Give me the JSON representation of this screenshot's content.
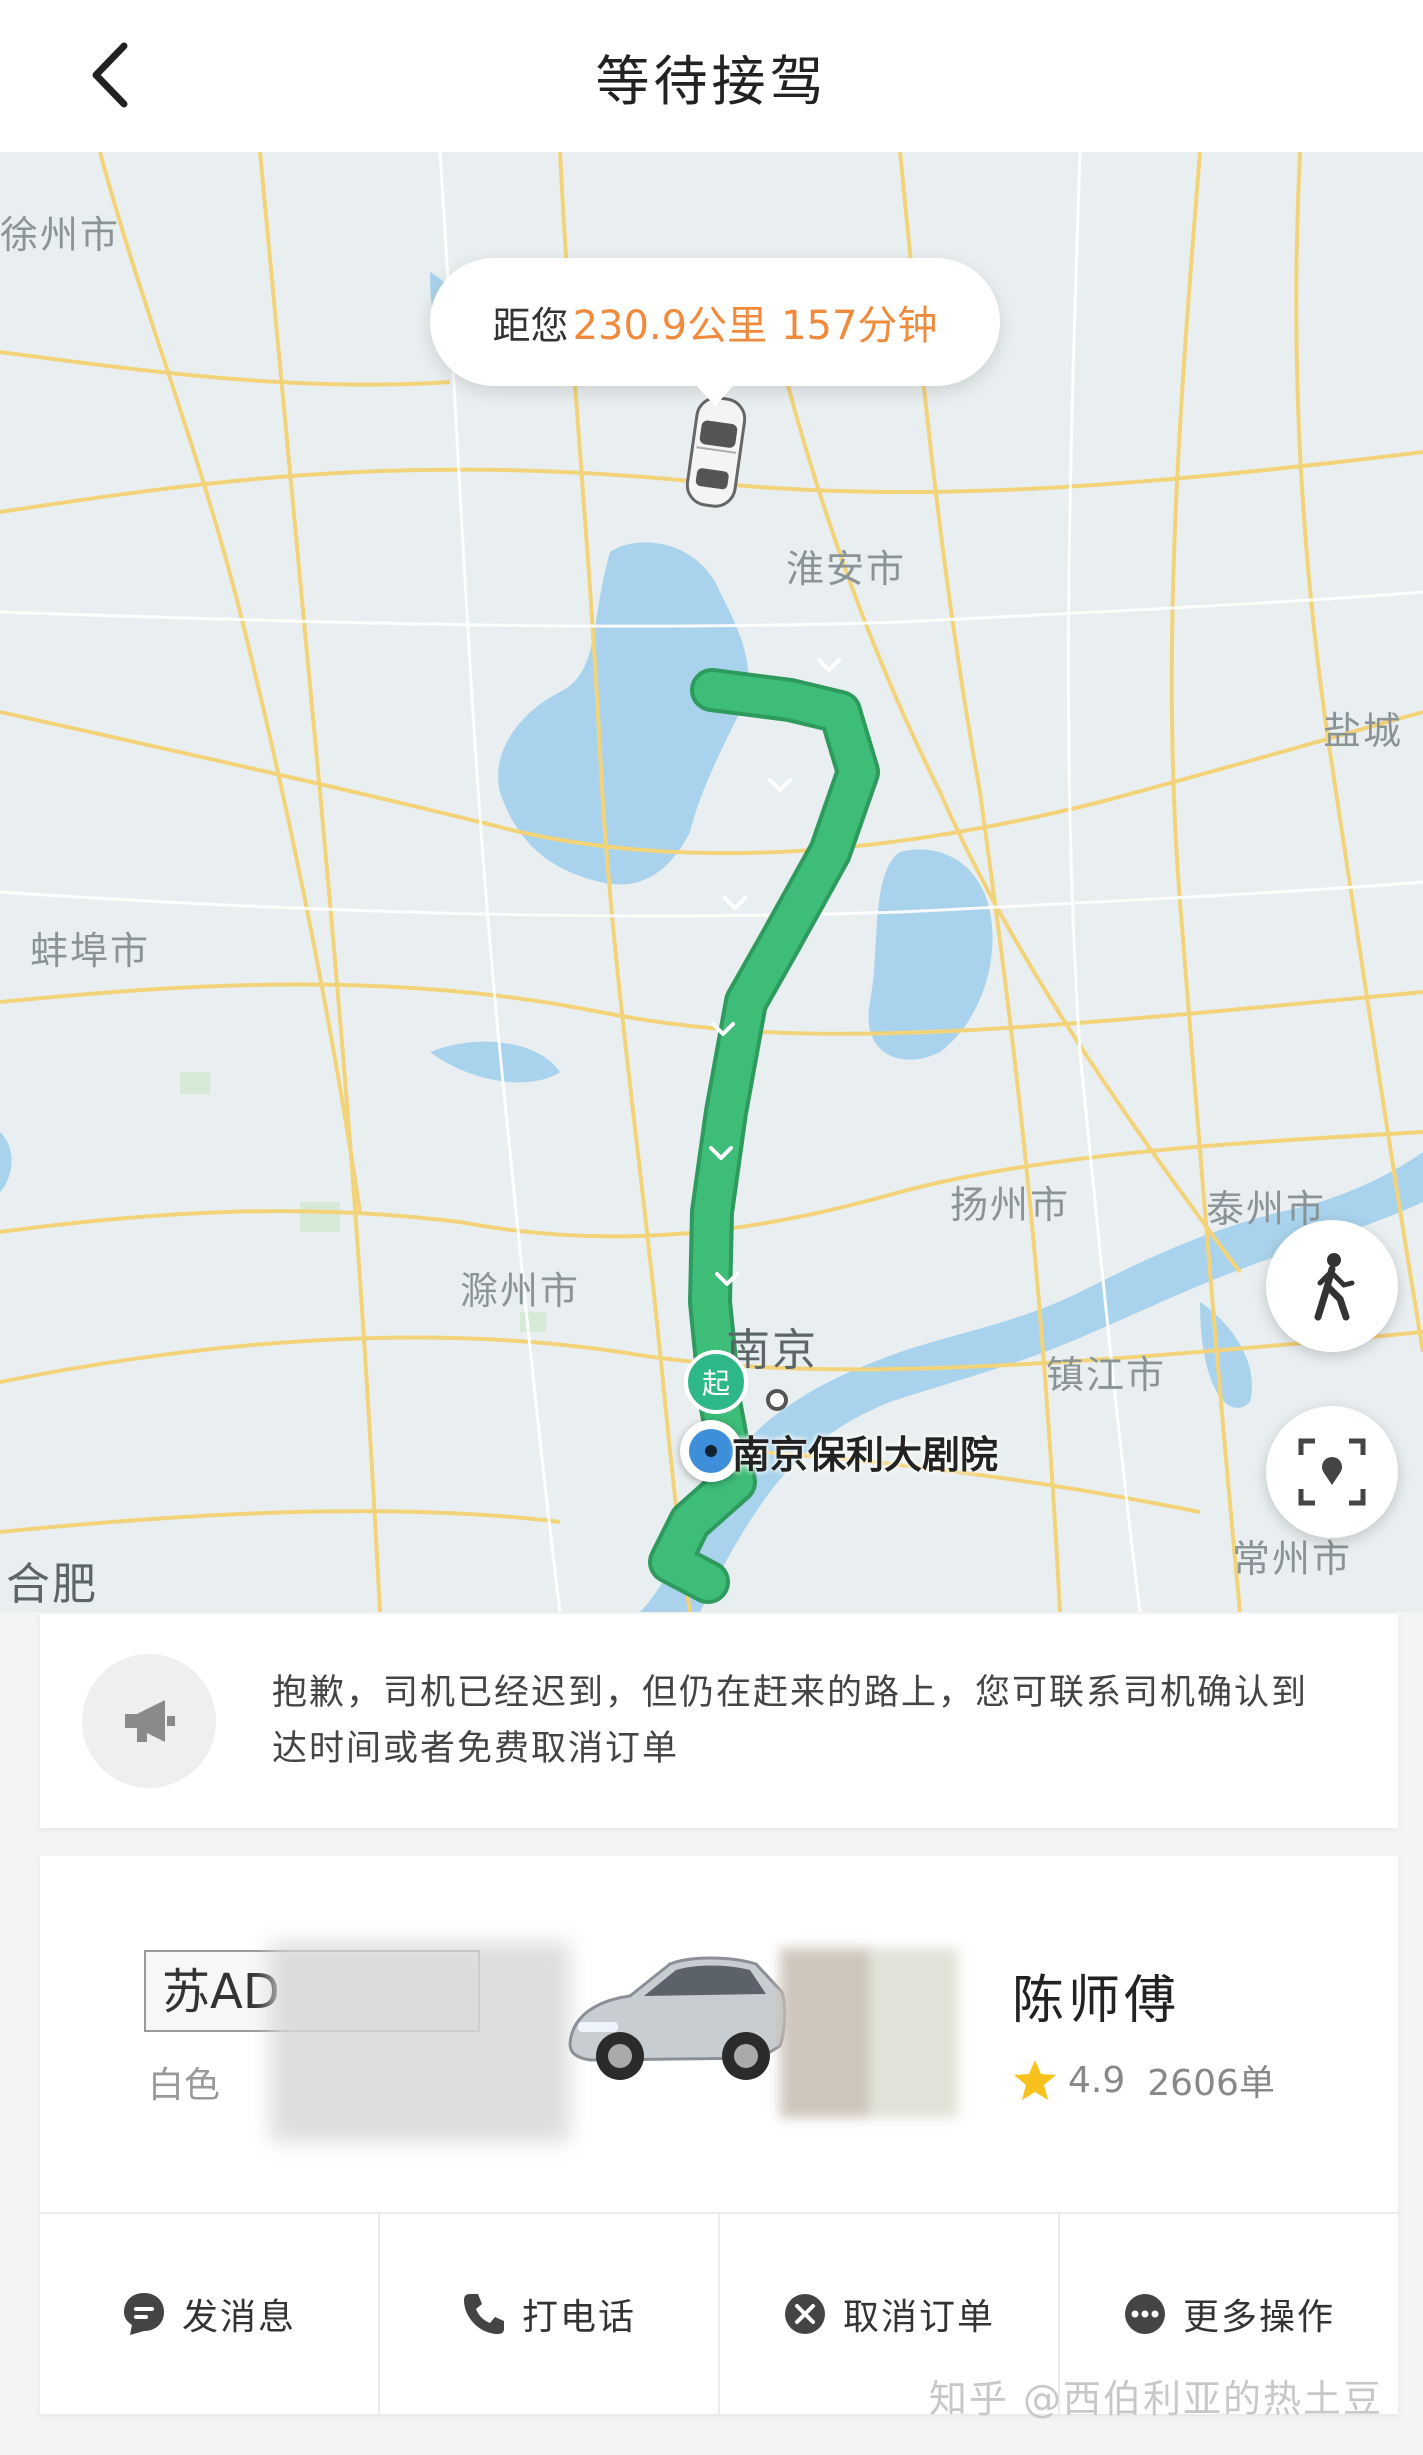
{
  "header": {
    "title": "等待接驾",
    "back_icon": "chevron-left-icon"
  },
  "map": {
    "eta": {
      "prefix": "距您",
      "distance": "230.9公里",
      "duration": "157分钟",
      "accent_color": "#f08a3c"
    },
    "route_color": "#3dbd78",
    "cities": [
      "徐州市",
      "淮安市",
      "盐城",
      "蚌埠市",
      "扬州市",
      "泰州市",
      "滁州市",
      "南京",
      "镇江市",
      "常州市",
      "合肥"
    ],
    "start_marker": "起",
    "start_name": "南京保利大剧院",
    "buttons": {
      "walk_icon": "walking-person-icon",
      "locate_icon": "locate-center-icon"
    }
  },
  "notice": {
    "icon": "megaphone-icon",
    "text": "抱歉，司机已经迟到，但仍在赶来的路上，您可联系司机确认到达时间或者免费取消订单"
  },
  "driver": {
    "plate": "苏AD",
    "car_color": "白色",
    "name": "陈师傅",
    "rating": "4.9",
    "orders": "2606单",
    "star_color": "#f7c21b"
  },
  "actions": [
    {
      "label": "发消息",
      "icon": "message-icon"
    },
    {
      "label": "打电话",
      "icon": "phone-icon"
    },
    {
      "label": "取消订单",
      "icon": "cancel-circle-icon"
    },
    {
      "label": "更多操作",
      "icon": "more-dots-icon"
    }
  ],
  "watermark": "知乎 @西伯利亚的热土豆"
}
